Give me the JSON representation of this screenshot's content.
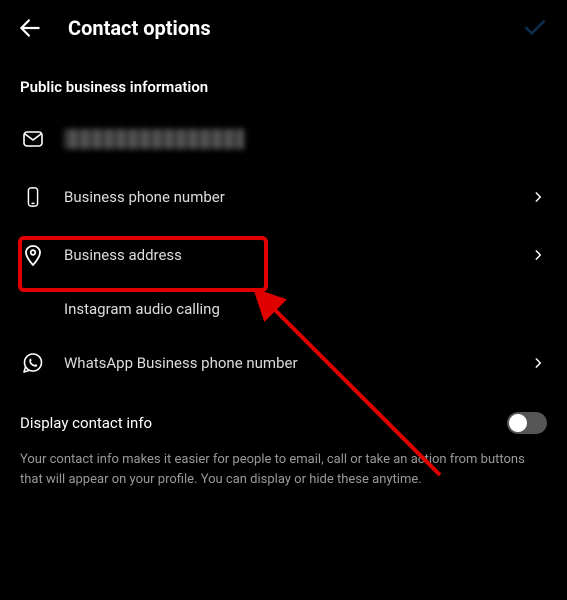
{
  "header": {
    "title": "Contact options"
  },
  "section1": {
    "header": "Public business information",
    "items": {
      "email": {
        "label": ""
      },
      "phone": {
        "label": "Business phone number"
      },
      "address": {
        "label": "Business address"
      },
      "audio": {
        "label": "Instagram audio calling"
      },
      "whatsapp": {
        "label": "WhatsApp Business phone number"
      }
    }
  },
  "section2": {
    "title": "Display contact info",
    "toggle_state": "off",
    "description": "Your contact info makes it easier for people to email, call or take an action from buttons that will appear on your profile. You can display or hide these anytime."
  },
  "annotation": {
    "highlight": "business-address-row",
    "arrow_color": "#e00000"
  }
}
